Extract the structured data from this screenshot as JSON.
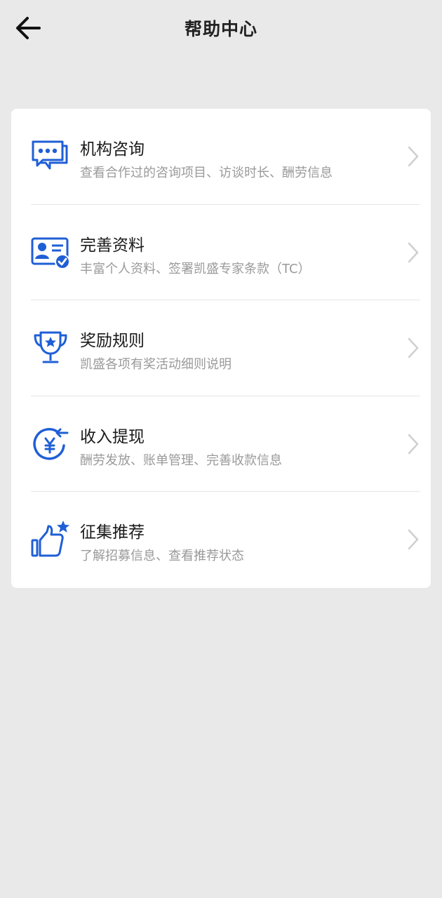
{
  "header": {
    "title": "帮助中心",
    "back_icon": "arrow-left-icon"
  },
  "accent_color": "#1f5fd6",
  "menu": {
    "items": [
      {
        "title": "机构咨询",
        "description": "查看合作过的咨询项目、访谈时长、酬劳信息",
        "icon": "chat-bubble-icon"
      },
      {
        "title": "完善资料",
        "description": "丰富个人资料、签署凯盛专家条款（TC）",
        "icon": "profile-card-check-icon"
      },
      {
        "title": "奖励规则",
        "description": "凯盛各项有奖活动细则说明",
        "icon": "trophy-icon"
      },
      {
        "title": "收入提现",
        "description": "酬劳发放、账单管理、完善收款信息",
        "icon": "yuan-withdraw-icon"
      },
      {
        "title": "征集推荐",
        "description": "了解招募信息、查看推荐状态",
        "icon": "thumbs-up-star-icon"
      }
    ]
  }
}
